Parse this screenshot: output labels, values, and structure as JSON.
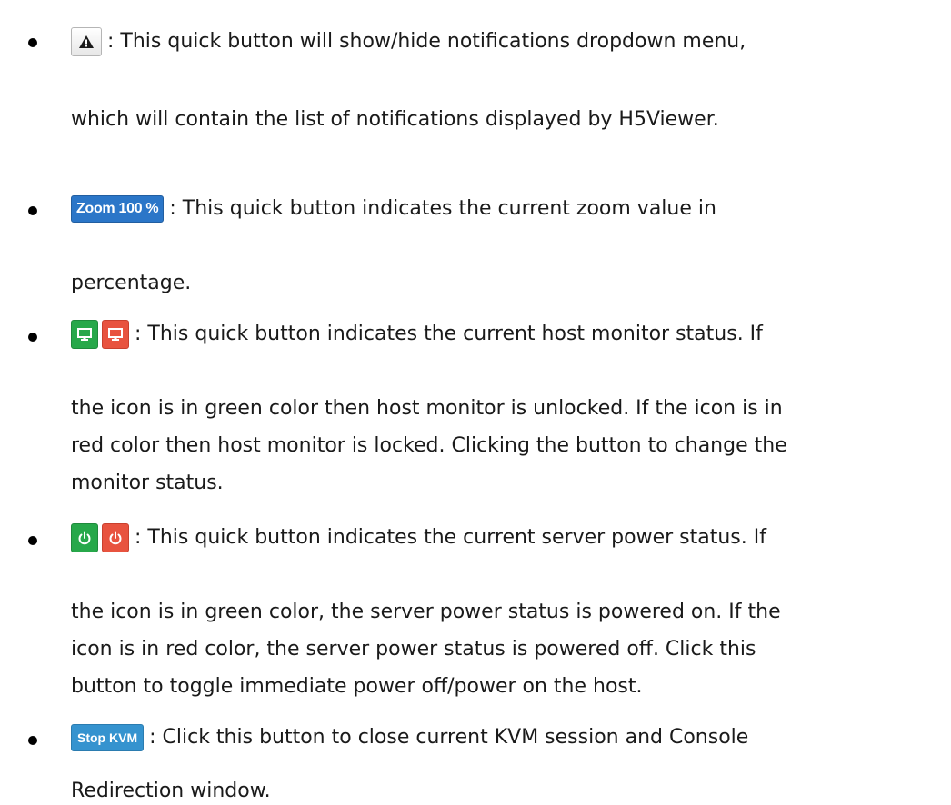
{
  "items": [
    {
      "button_icons": [
        "warning-icon"
      ],
      "lines": [
        ": This quick button will show/hide notifications dropdown menu,",
        "which will contain the list of notifications displayed by H5Viewer."
      ]
    },
    {
      "button_label": "Zoom 100 %",
      "lines": [
        ": This quick button indicates the current zoom value in",
        "percentage."
      ]
    },
    {
      "button_icons": [
        "monitor-icon",
        "monitor-icon"
      ],
      "button_colors": [
        "#27a84a",
        "#e8533f"
      ],
      "lines": [
        ": This quick button indicates the current host monitor status. If",
        "the icon is in green color then host monitor is unlocked. If the icon is in",
        "red color then host monitor is locked. Clicking the button to change the",
        "monitor status."
      ]
    },
    {
      "button_icons": [
        "power-icon",
        "power-icon"
      ],
      "button_colors": [
        "#27a84a",
        "#e8533f"
      ],
      "lines": [
        ": This quick button indicates the current server power status. If",
        "the icon is in green color, the server power status is powered on. If the",
        "icon is in red color, the server power status is powered off. Click this",
        "button to toggle immediate power off/power on the host."
      ]
    },
    {
      "button_label": "Stop KVM",
      "lines": [
        ": Click this button to close current KVM session and Console",
        "Redirection window."
      ]
    }
  ]
}
